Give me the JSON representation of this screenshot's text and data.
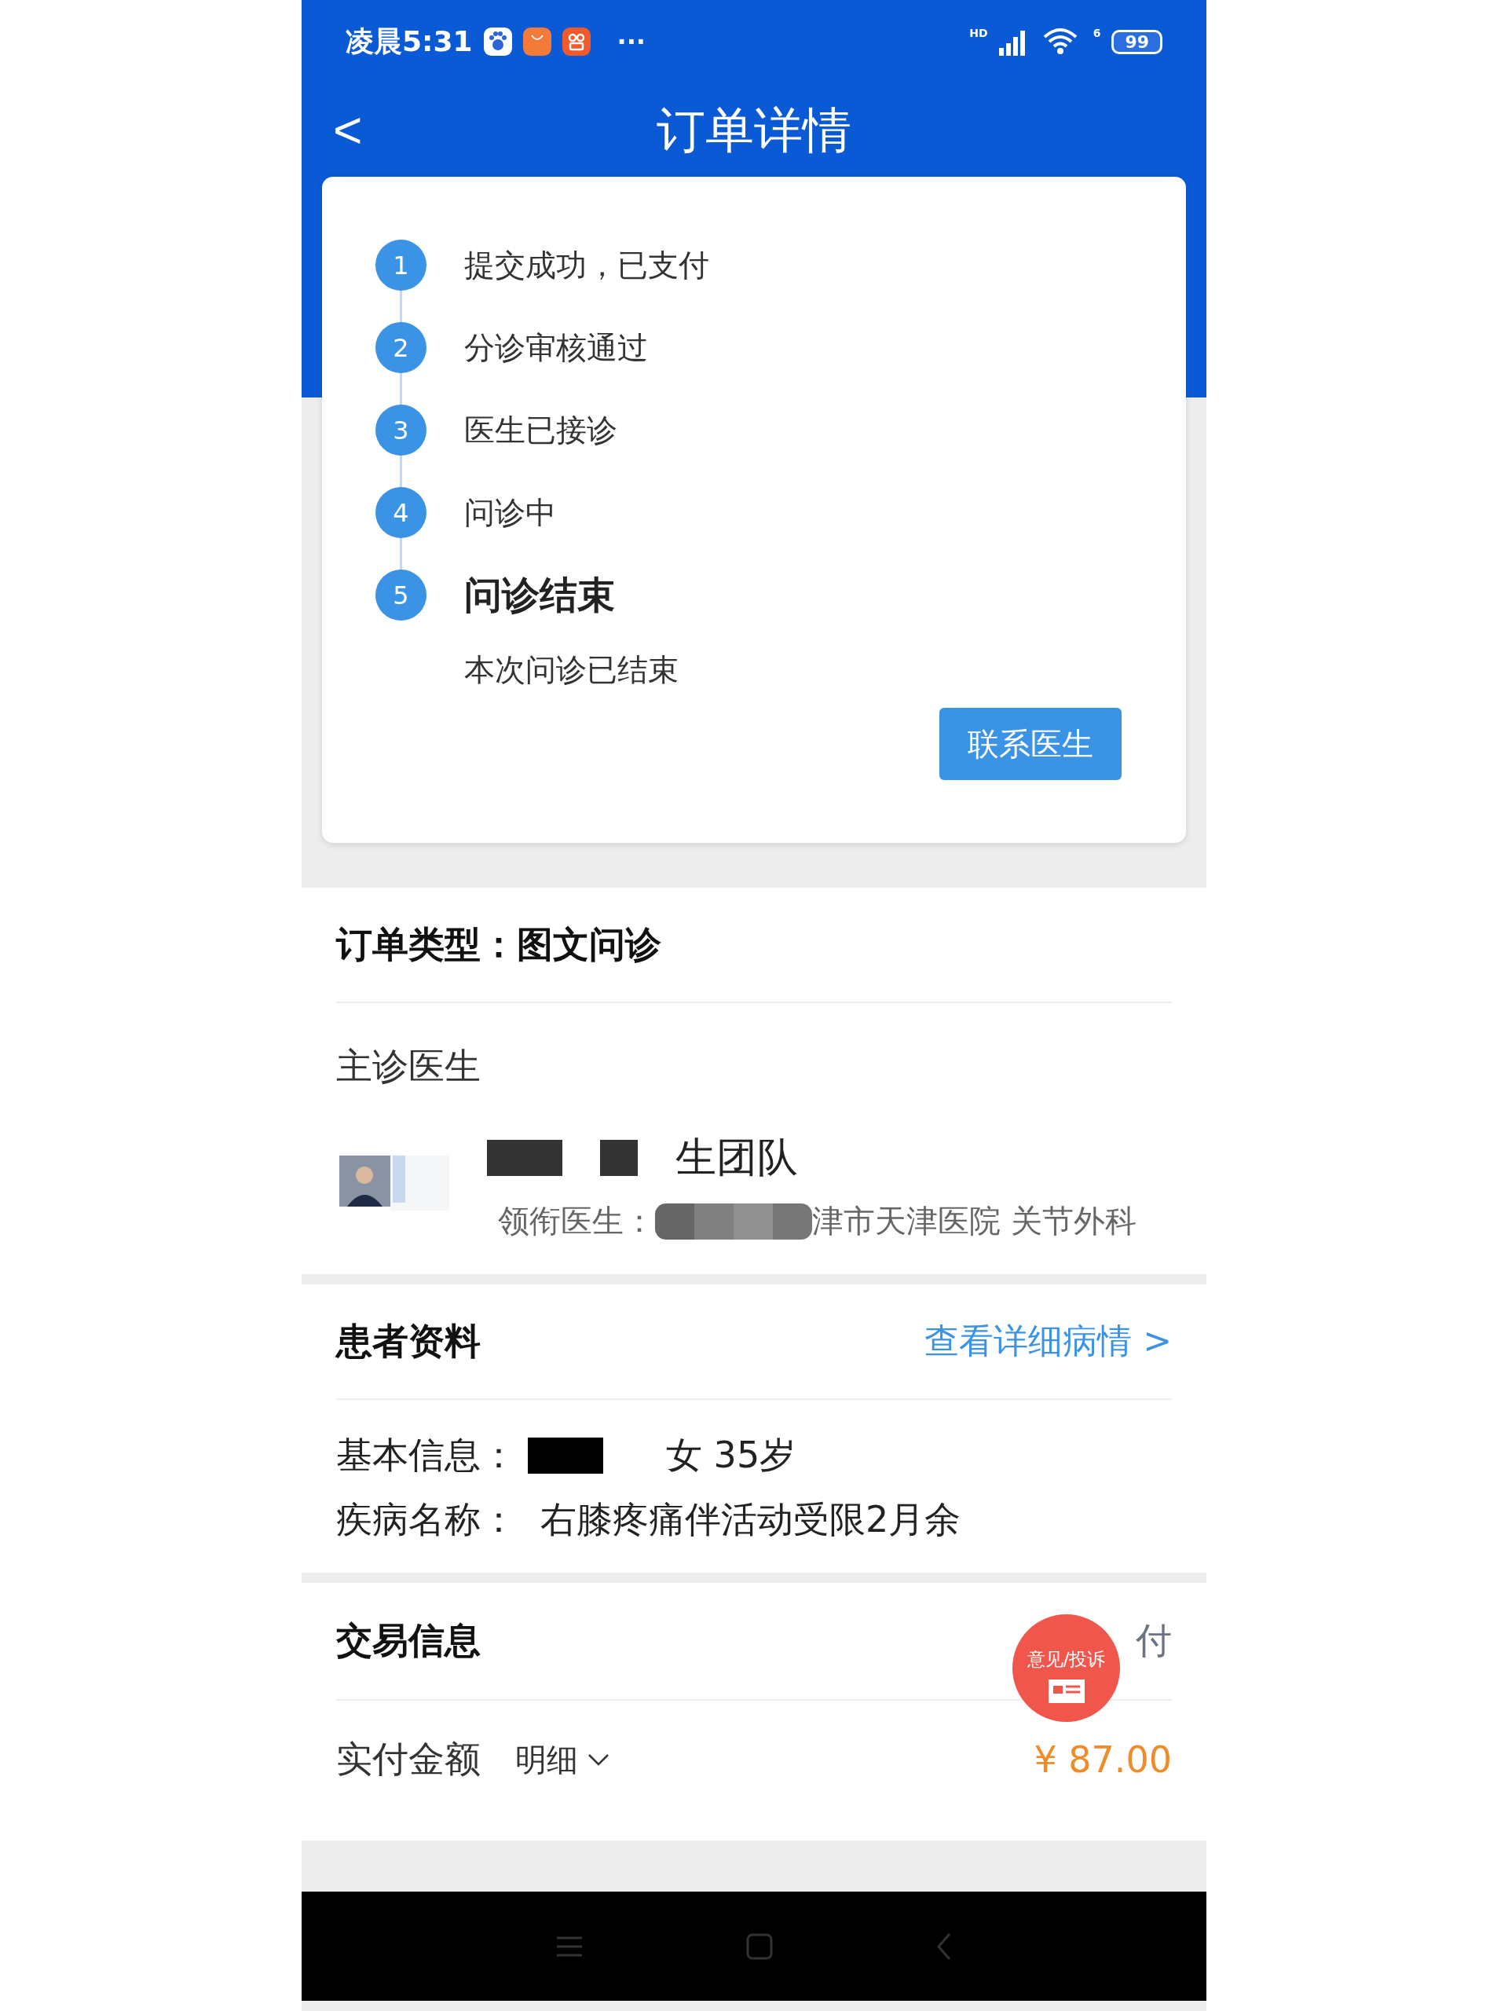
{
  "status_bar": {
    "time": "凌晨5:31",
    "more": "···",
    "network": "HD",
    "battery": "99",
    "wifi_label": "6"
  },
  "header": {
    "back": "<",
    "title": "订单详情"
  },
  "steps": [
    {
      "number": "1",
      "label": "提交成功，已支付",
      "current": false
    },
    {
      "number": "2",
      "label": "分诊审核通过",
      "current": false
    },
    {
      "number": "3",
      "label": "医生已接诊",
      "current": false
    },
    {
      "number": "4",
      "label": "问诊中",
      "current": false
    },
    {
      "number": "5",
      "label": "问诊结束",
      "current": true,
      "note": "本次问诊已结束"
    }
  ],
  "contact_button": "联系医生",
  "order_type": "订单类型：图文问诊",
  "doctor": {
    "heading": "主诊医生",
    "team": "生团队",
    "lead_label": "领衔医生：",
    "hospital": "津市天津医院 关节外科"
  },
  "patient": {
    "heading": "患者资料",
    "link": "查看详细病情 >",
    "basic_label": "基本信息：",
    "basic_value": "女 35岁",
    "disease_label": "疾病名称：",
    "disease": "右膝疼痛伴活动受限2月余"
  },
  "trade": {
    "heading": "交易信息",
    "status": "付",
    "amount_label": "实付金额",
    "detail": "明细",
    "amount": "¥ 87.00"
  },
  "feedback_button": "意见/投诉"
}
